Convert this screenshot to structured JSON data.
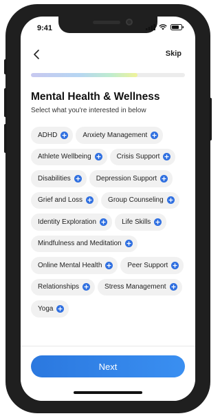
{
  "status_bar": {
    "time": "9:41"
  },
  "nav": {
    "skip_label": "Skip",
    "back_icon": "chevron-left-icon"
  },
  "progress": {
    "fraction": 0.69
  },
  "header": {
    "title": "Mental Health & Wellness",
    "subtitle": "Select what you're interested in below"
  },
  "topics": [
    "ADHD",
    "Anxiety Management",
    "Athlete Wellbeing",
    "Crisis Support",
    "Disabilities",
    "Depression Support",
    "Grief and Loss",
    "Group Counseling",
    "Identity Exploration",
    "Life Skills",
    "Mindfulness and Meditation",
    "Online Mental Health",
    "Peer Support",
    "Relationships",
    "Stress Management",
    "Yoga"
  ],
  "footer": {
    "next_label": "Next"
  },
  "colors": {
    "accent": "#2f6fe0",
    "chip_bg": "#f1f1f1"
  }
}
